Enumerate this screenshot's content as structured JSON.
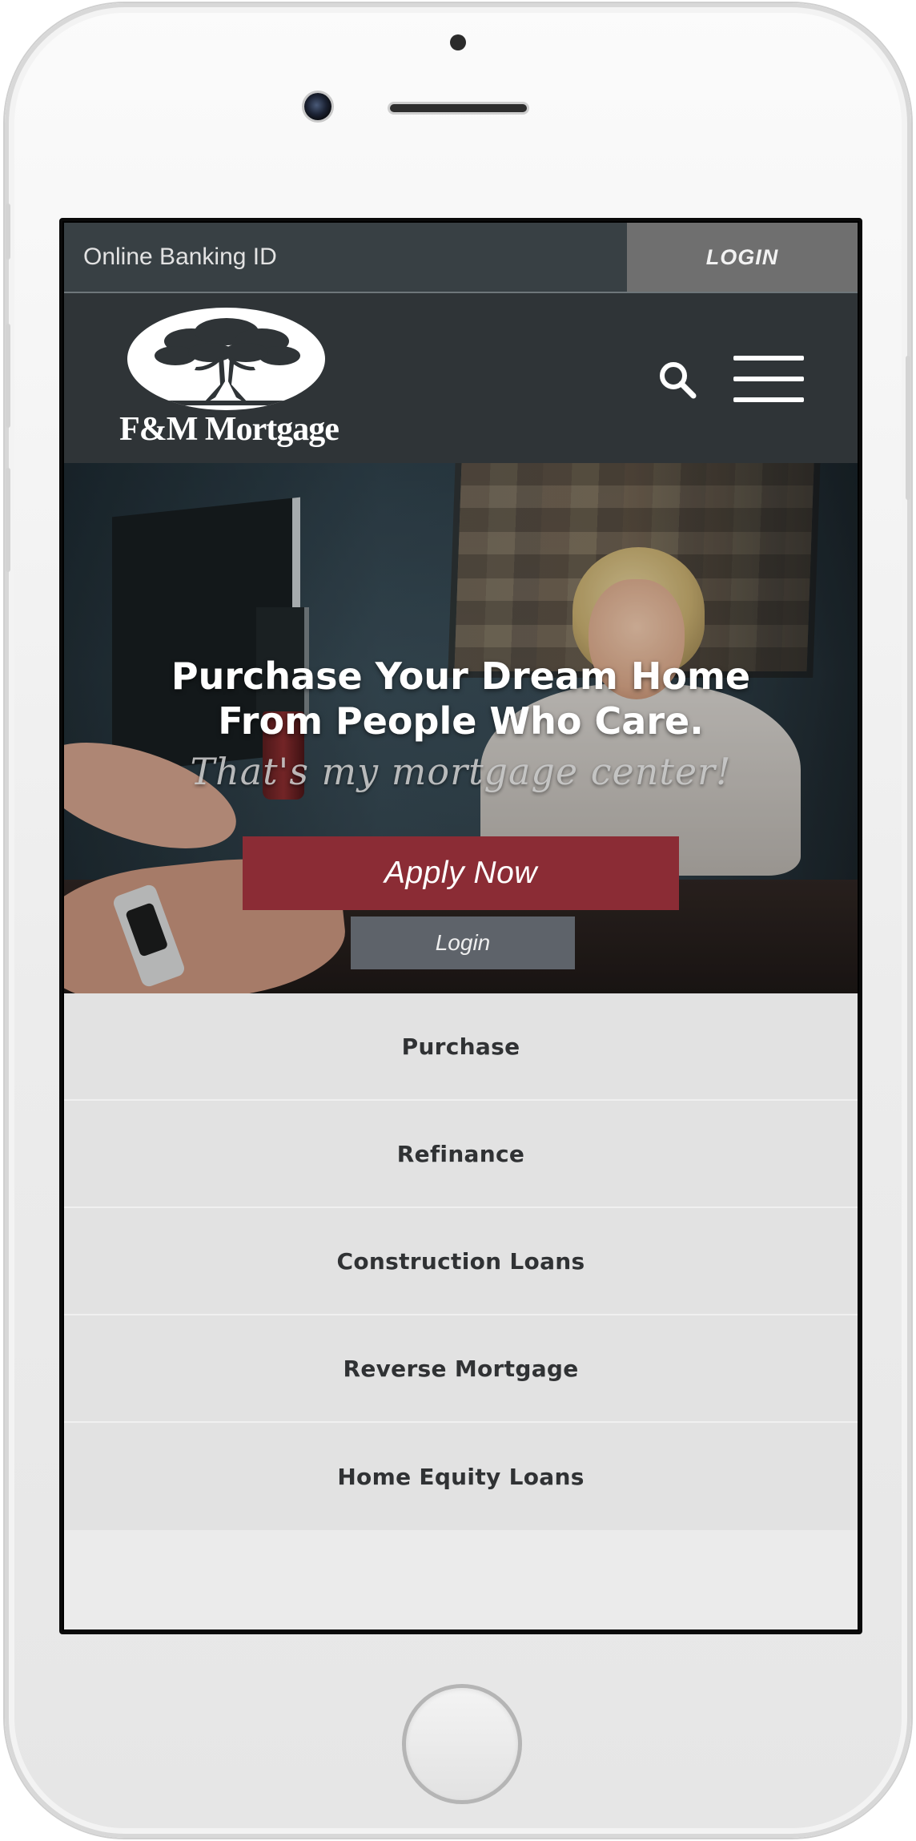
{
  "topbar": {
    "banking_placeholder": "Online Banking ID",
    "login_label": "LOGIN"
  },
  "header": {
    "logo_text": "F&M Mortgage",
    "icons": [
      "search-icon",
      "hamburger-menu-icon"
    ]
  },
  "hero": {
    "title_line1": "Purchase Your Dream Home",
    "title_line2": "From People Who Care.",
    "tagline": "That's my mortgage center!",
    "apply_label": "Apply Now",
    "login_label": "Login"
  },
  "loan_menu": {
    "items": [
      {
        "label": "Purchase"
      },
      {
        "label": "Refinance"
      },
      {
        "label": "Construction Loans"
      },
      {
        "label": "Reverse Mortgage"
      },
      {
        "label": "Home Equity Loans"
      }
    ]
  },
  "colors": {
    "topbar": "#384044",
    "header": "#2f3437",
    "apply_button": "#8b2c35",
    "login_button": "#6f6f6f",
    "menu_item_bg": "#e2e2e2"
  }
}
